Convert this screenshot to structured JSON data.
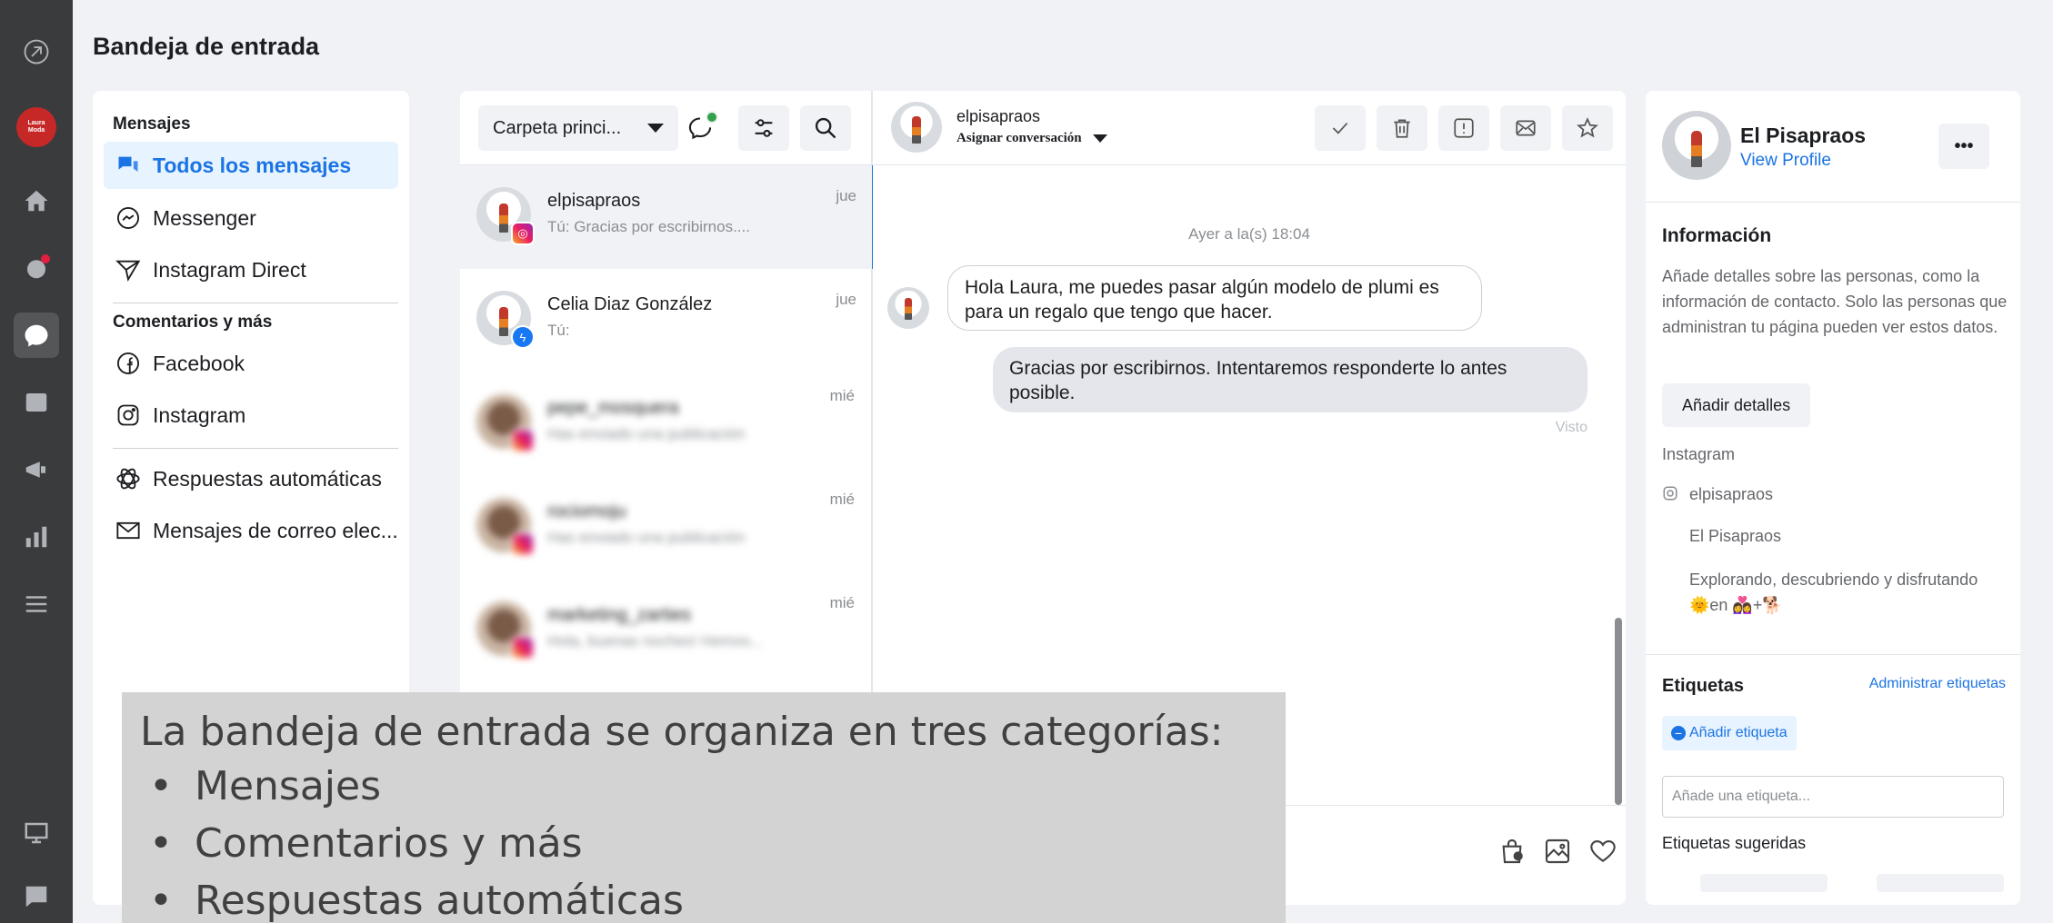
{
  "app": {
    "logo_text": "Laura\nModa"
  },
  "page": {
    "title": "Bandeja de entrada"
  },
  "rail": {
    "icons": [
      "meta-logo-icon",
      "home-icon",
      "notifications-icon",
      "inbox-icon",
      "posts-icon",
      "ads-icon",
      "insights-icon",
      "menu-icon",
      "desktop-icon",
      "feedback-icon"
    ]
  },
  "nav": {
    "section1": "Mensajes",
    "items1": [
      {
        "label": "Todos los mensajes",
        "icon": "chat-bubbles-icon"
      },
      {
        "label": "Messenger",
        "icon": "messenger-icon"
      },
      {
        "label": "Instagram Direct",
        "icon": "send-icon"
      }
    ],
    "section2": "Comentarios y más",
    "items2": [
      {
        "label": "Facebook",
        "icon": "facebook-icon"
      },
      {
        "label": "Instagram",
        "icon": "instagram-icon"
      }
    ],
    "items3": [
      {
        "label": "Respuestas automáticas",
        "icon": "automation-icon"
      },
      {
        "label": "Mensajes de correo elec...",
        "icon": "mail-icon"
      }
    ]
  },
  "list": {
    "folder": "Carpeta princi...",
    "conversations": [
      {
        "name": "elpisapraos",
        "snippet": "Tú: Gracias por escribirnos....",
        "time": "jue",
        "badge": "instagram"
      },
      {
        "name": "Celia Diaz González",
        "snippet": "Tú:",
        "time": "jue",
        "badge": "messenger"
      },
      {
        "name": "pepe_mosquera",
        "snippet": "Has enviado una publicación",
        "time": "mié",
        "badge": "instagram"
      },
      {
        "name": "rociomoju",
        "snippet": "Has enviado una publicación",
        "time": "mié",
        "badge": "instagram"
      },
      {
        "name": "marketing_zarties",
        "snippet": "Hola, buenas noches! Hemos...",
        "time": "mié",
        "badge": "instagram"
      }
    ]
  },
  "chat": {
    "name": "elpisapraos",
    "assign": "Asignar conversación",
    "timestamp": "Ayer a la(s) 18:04",
    "incoming": "Hola Laura,  me puedes pasar algún modelo de plumi es para un regalo que tengo que hacer.",
    "outgoing": "Gracias por escribirnos. Intentaremos responderte lo antes posible.",
    "seen": "Visto"
  },
  "info": {
    "name": "El Pisapraos",
    "view_profile": "View Profile",
    "more": "•••",
    "section_info": "Información",
    "info_text": "Añade detalles sobre las personas, como la información de contacto. Solo las personas que administran tu página pueden ver estos datos.",
    "add_details": "Añadir detalles",
    "instagram_label": "Instagram",
    "ig_handle": "elpisapraos",
    "ig_name": "El Pisapraos",
    "ig_bio": "Explorando, descubriendo y disfrutando 🌞en 👩‍❤️‍👩+🐕",
    "tags_heading": "Etiquetas",
    "manage_tags": "Administrar etiquetas",
    "add_tag": "Añadir etiqueta",
    "tag_placeholder": "Añade una etiqueta...",
    "suggested": "Etiquetas sugeridas"
  },
  "overlay": {
    "title": "La bandeja de entrada se organiza en tres categorías:",
    "items": [
      "Mensajes",
      "Comentarios y más",
      "Respuestas automáticas"
    ]
  },
  "colors": {
    "accent": "#1b74e4",
    "rail": "#3a3b3c",
    "background": "#f0f2f5"
  }
}
